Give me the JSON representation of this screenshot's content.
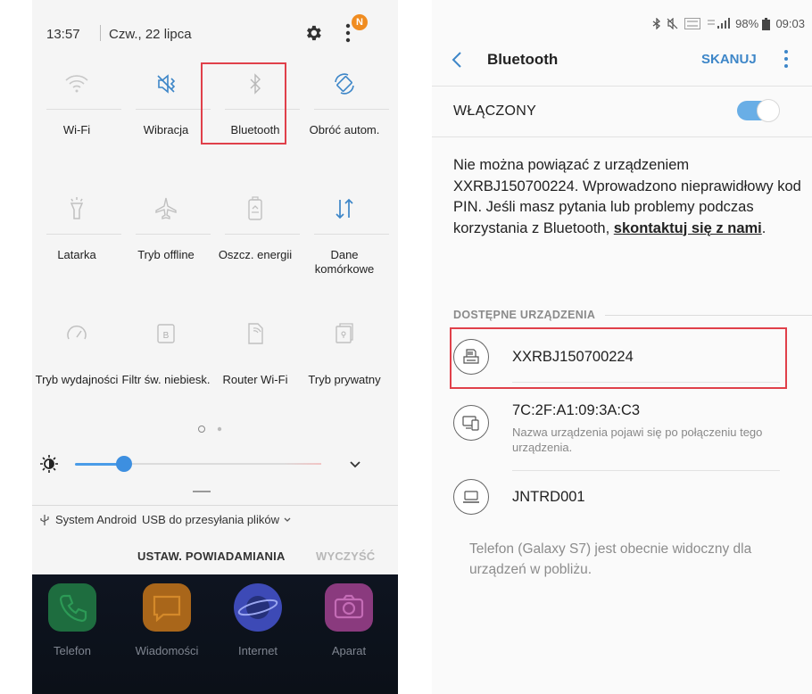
{
  "left": {
    "status": {
      "time": "13:57",
      "date": "Czw., 22 lipca",
      "badge": "N"
    },
    "tiles": [
      {
        "id": "wifi",
        "label": "Wi-Fi",
        "icon": "wifi-icon"
      },
      {
        "id": "vibration",
        "label": "Wibracja",
        "icon": "vibrate-icon",
        "active": true
      },
      {
        "id": "bluetooth",
        "label": "Bluetooth",
        "icon": "bluetooth-icon",
        "highlighted": true
      },
      {
        "id": "rotate",
        "label": "Obróć autom.",
        "icon": "auto-rotate-icon",
        "active": true
      },
      {
        "id": "flashlight",
        "label": "Latarka",
        "icon": "flashlight-icon"
      },
      {
        "id": "airplane",
        "label": "Tryb offline",
        "icon": "airplane-icon"
      },
      {
        "id": "powersave",
        "label": "Oszcz. energii",
        "icon": "battery-saver-icon"
      },
      {
        "id": "mobiledata",
        "label": "Dane komórkowe",
        "icon": "mobile-data-icon",
        "active": true
      },
      {
        "id": "performance",
        "label": "Tryb wydajności",
        "icon": "gauge-icon"
      },
      {
        "id": "bluefilter",
        "label": "Filtr św. niebiesk.",
        "icon": "blue-light-filter-icon"
      },
      {
        "id": "hotspot",
        "label": "Router Wi-Fi",
        "icon": "hotspot-icon"
      },
      {
        "id": "private",
        "label": "Tryb prywatny",
        "icon": "private-mode-icon"
      }
    ],
    "brightness_level": 0.2,
    "notification": {
      "app": "System Android",
      "text": "USB do przesyłania plików"
    },
    "actions": {
      "settings": "USTAW. POWIADAMIANIA",
      "clear": "WYCZYŚĆ"
    },
    "dock": [
      {
        "label": "Telefon",
        "color": "#1f7a45"
      },
      {
        "label": "Wiadomości",
        "color": "#b8701c"
      },
      {
        "label": "Internet",
        "color": "#4a58c8"
      },
      {
        "label": "Aparat",
        "color": "#9a3f8c"
      }
    ]
  },
  "right": {
    "status": {
      "battery": "98%",
      "time": "09:03"
    },
    "header": {
      "title": "Bluetooth",
      "scan": "SKANUJ"
    },
    "switch": {
      "label": "WŁĄCZONY",
      "on": true
    },
    "message": {
      "text": "Nie można powiązać z urządzeniem XXRBJ150700224. Wprowadzono nieprawidłowy kod PIN. Jeśli masz pytania lub problemy podczas korzystania z Bluetooth,",
      "link": "skontaktuj się z nami",
      "end": "."
    },
    "section": "DOSTĘPNE URZĄDZENIA",
    "devices": [
      {
        "name": "XXRBJ150700224",
        "icon": "printer-icon",
        "sub": ""
      },
      {
        "name": "7C:2F:A1:09:3A:C3",
        "icon": "devices-icon",
        "sub": "Nazwa urządzenia pojawi się po połączeniu tego urządzenia."
      },
      {
        "name": "JNTRD001",
        "icon": "laptop-icon",
        "sub": ""
      }
    ],
    "footer": "Telefon (Galaxy S7) jest obecnie widoczny dla urządzeń w pobliżu."
  }
}
